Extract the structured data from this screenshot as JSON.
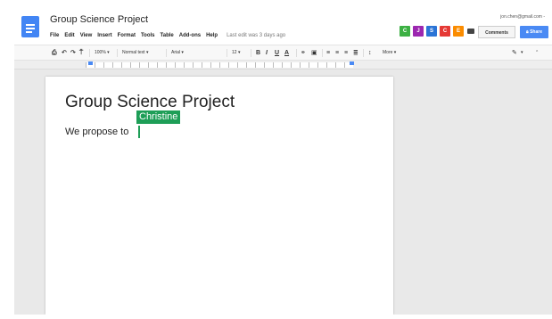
{
  "document": {
    "title": "Group Science Project",
    "heading": "Group Science Project",
    "body_text": "We propose to"
  },
  "menu": {
    "items": [
      "File",
      "Edit",
      "View",
      "Insert",
      "Format",
      "Tools",
      "Table",
      "Add-ons",
      "Help"
    ],
    "last_edit": "Last edit was 3 days ago"
  },
  "account": {
    "email": "jon.chen@gmail.com -"
  },
  "collaborators": [
    {
      "initial": "C",
      "color": "#3cb043"
    },
    {
      "initial": "J",
      "color": "#9c27b0"
    },
    {
      "initial": "S",
      "color": "#2b74d6"
    },
    {
      "initial": "C",
      "color": "#e53935"
    },
    {
      "initial": "E",
      "color": "#fb8c00"
    }
  ],
  "buttons": {
    "comments": "Comments",
    "share": "Share"
  },
  "toolbar": {
    "zoom": "100%",
    "style": "Normal text",
    "font": "Arial",
    "size": "12",
    "more": "More"
  },
  "cursor": {
    "name": "Christine",
    "color": "#1e9e57"
  },
  "colors": {
    "accent": "#4285f4",
    "share": "#4a8af4"
  },
  "icons": [
    "docs-icon",
    "print-icon",
    "undo-icon",
    "redo-icon",
    "paint-format-icon",
    "bold-icon",
    "italic-icon",
    "underline-icon",
    "text-color-icon",
    "link-icon",
    "comment-icon",
    "align-left-icon",
    "align-center-icon",
    "align-right-icon",
    "justify-icon",
    "line-spacing-icon",
    "pen-icon",
    "collapse-icon",
    "chat-icon"
  ]
}
